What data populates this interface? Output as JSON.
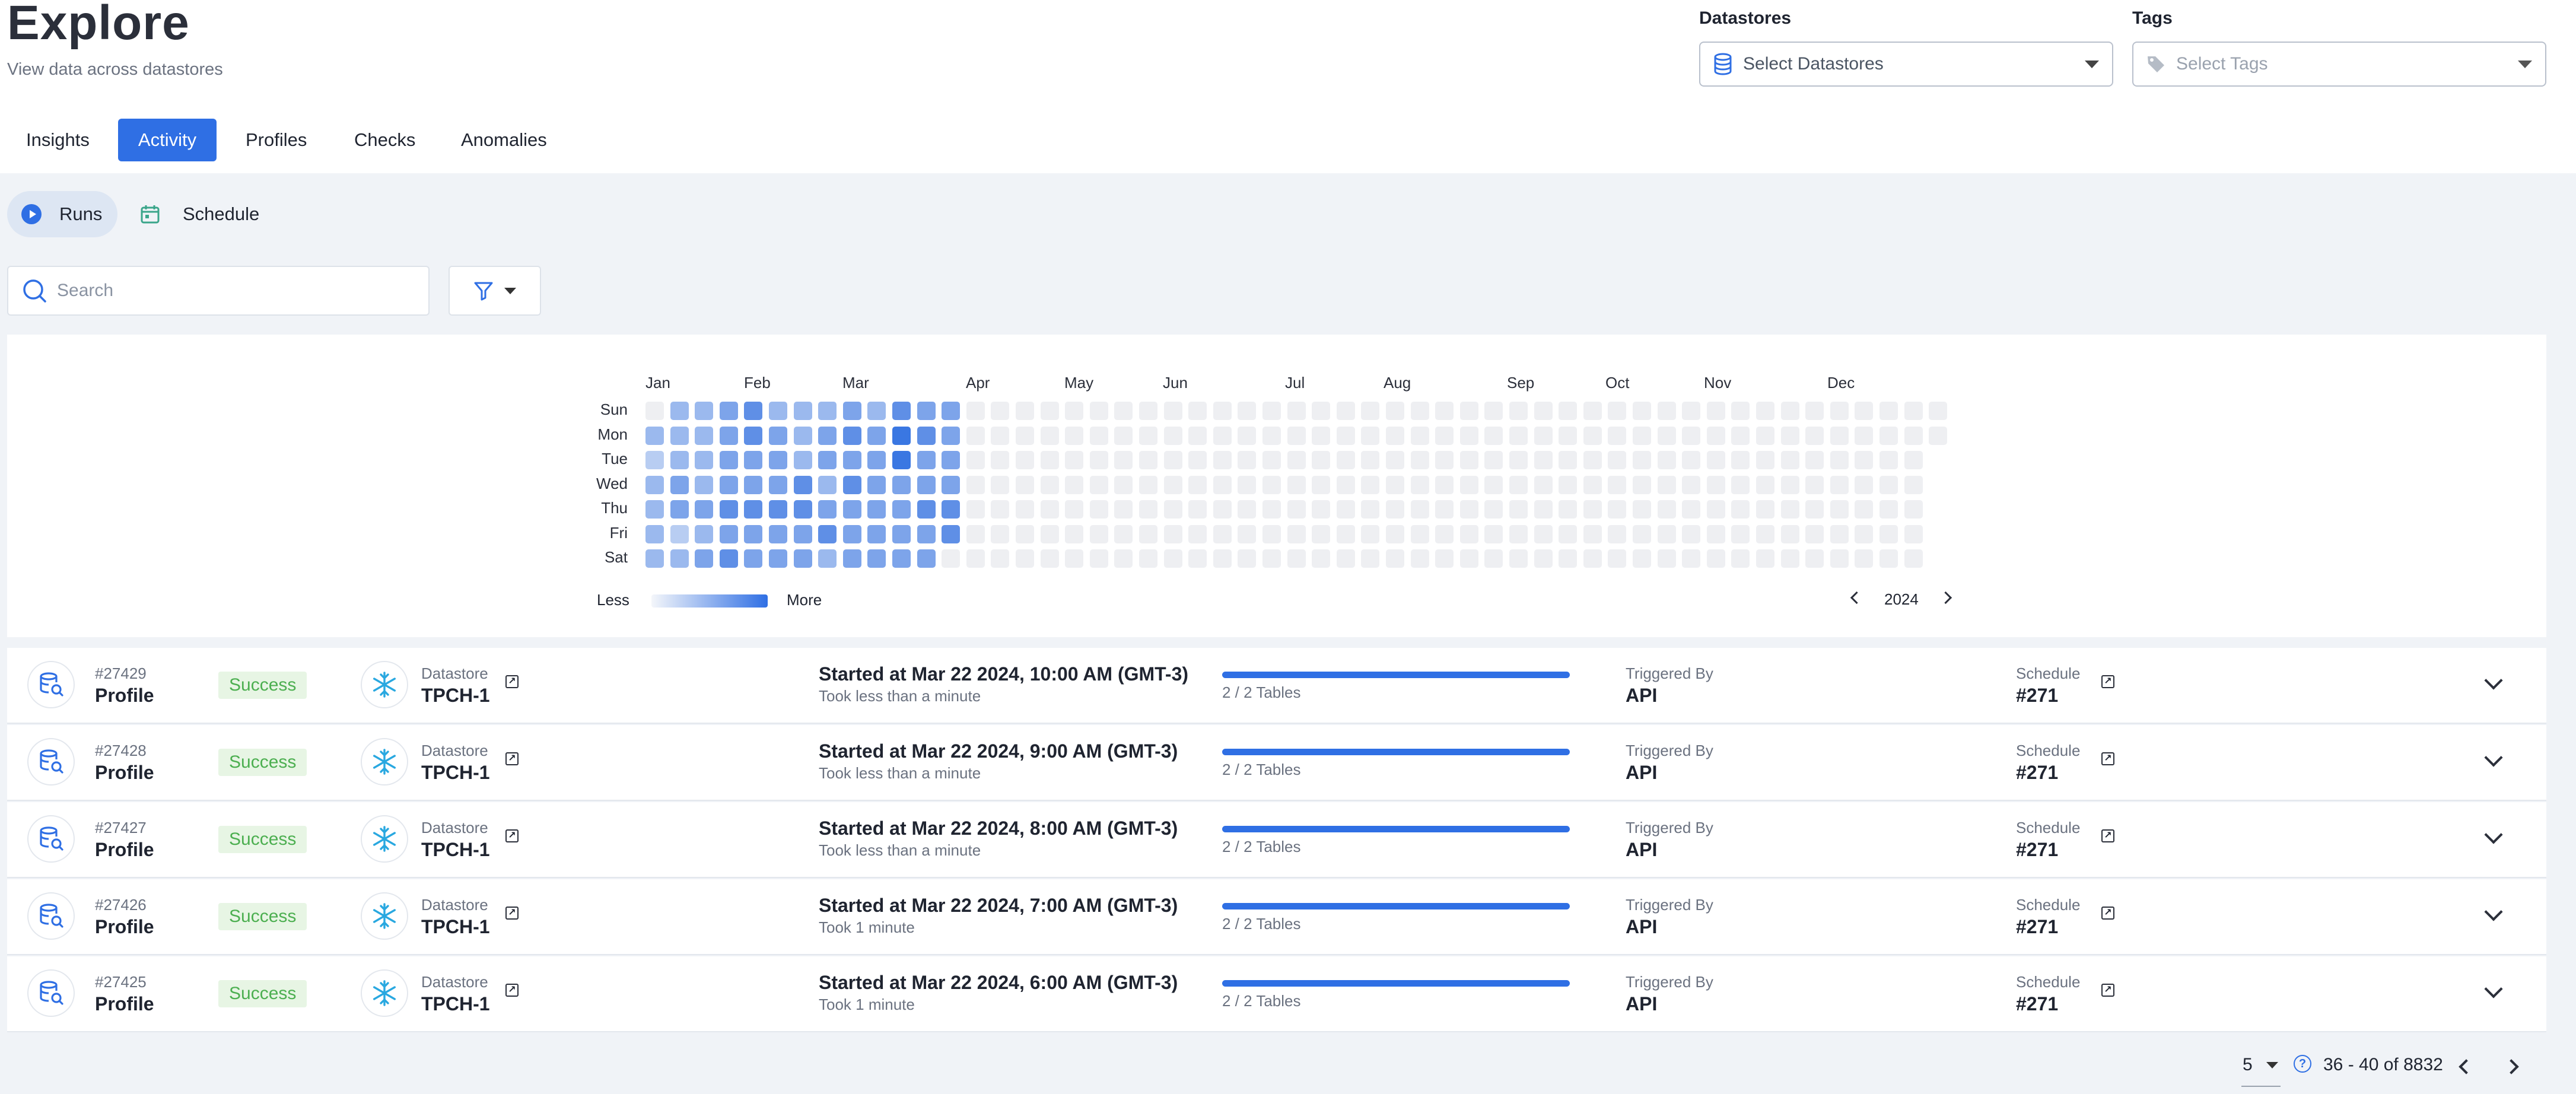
{
  "header": {
    "title": "Explore",
    "subtitle": "View data across datastores"
  },
  "filters": {
    "datastores_label": "Datastores",
    "datastores_placeholder": "Select Datastores",
    "tags_label": "Tags",
    "tags_placeholder": "Select Tags"
  },
  "tabs": [
    {
      "label": "Insights"
    },
    {
      "label": "Activity",
      "active": true
    },
    {
      "label": "Profiles"
    },
    {
      "label": "Checks"
    },
    {
      "label": "Anomalies"
    }
  ],
  "subtabs": {
    "runs": "Runs",
    "schedule": "Schedule"
  },
  "search": {
    "placeholder": "Search"
  },
  "heatmap": {
    "months": [
      "Jan",
      "Feb",
      "Mar",
      "Apr",
      "May",
      "Jun",
      "Jul",
      "Aug",
      "Sep",
      "Oct",
      "Nov",
      "Dec"
    ],
    "days": [
      "Sun",
      "Mon",
      "Tue",
      "Wed",
      "Thu",
      "Fri",
      "Sat"
    ],
    "legend_less": "Less",
    "legend_more": "More",
    "year": "2024",
    "colors": [
      "#eeeff2",
      "#b8cdf2",
      "#9bb9ee",
      "#7da4ea",
      "#5f8fe6",
      "#3a77e2"
    ],
    "activity_levels_by_week": [
      [
        0,
        2,
        1,
        2,
        2,
        2,
        2
      ],
      [
        2,
        2,
        2,
        3,
        3,
        1,
        2
      ],
      [
        2,
        2,
        2,
        2,
        3,
        2,
        3
      ],
      [
        3,
        3,
        3,
        3,
        4,
        3,
        4
      ],
      [
        4,
        4,
        3,
        3,
        4,
        3,
        3
      ],
      [
        2,
        3,
        3,
        3,
        4,
        3,
        3
      ],
      [
        2,
        2,
        2,
        4,
        4,
        3,
        3
      ],
      [
        2,
        3,
        3,
        2,
        3,
        4,
        2
      ],
      [
        3,
        4,
        3,
        4,
        3,
        3,
        3
      ],
      [
        2,
        3,
        3,
        3,
        3,
        3,
        3
      ],
      [
        4,
        5,
        5,
        3,
        3,
        3,
        3
      ],
      [
        3,
        4,
        3,
        3,
        4,
        3,
        3
      ],
      [
        3,
        3,
        3,
        3,
        4,
        4,
        0
      ]
    ],
    "total_weeks": 53
  },
  "runs": [
    {
      "id": "#27429",
      "type": "Profile",
      "status": "Success",
      "datastore_label": "Datastore",
      "datastore": "TPCH-1",
      "started": "Started at Mar 22 2024, 10:00 AM (GMT-3)",
      "took": "Took less than a minute",
      "progress_text": "2 / 2 Tables",
      "progress": 1.0,
      "triggered_label": "Triggered By",
      "triggered": "API",
      "schedule_label": "Schedule",
      "schedule": "#271"
    },
    {
      "id": "#27428",
      "type": "Profile",
      "status": "Success",
      "datastore_label": "Datastore",
      "datastore": "TPCH-1",
      "started": "Started at Mar 22 2024, 9:00 AM (GMT-3)",
      "took": "Took less than a minute",
      "progress_text": "2 / 2 Tables",
      "progress": 1.0,
      "triggered_label": "Triggered By",
      "triggered": "API",
      "schedule_label": "Schedule",
      "schedule": "#271"
    },
    {
      "id": "#27427",
      "type": "Profile",
      "status": "Success",
      "datastore_label": "Datastore",
      "datastore": "TPCH-1",
      "started": "Started at Mar 22 2024, 8:00 AM (GMT-3)",
      "took": "Took less than a minute",
      "progress_text": "2 / 2 Tables",
      "progress": 1.0,
      "triggered_label": "Triggered By",
      "triggered": "API",
      "schedule_label": "Schedule",
      "schedule": "#271"
    },
    {
      "id": "#27426",
      "type": "Profile",
      "status": "Success",
      "datastore_label": "Datastore",
      "datastore": "TPCH-1",
      "started": "Started at Mar 22 2024, 7:00 AM (GMT-3)",
      "took": "Took 1 minute",
      "progress_text": "2 / 2 Tables",
      "progress": 1.0,
      "triggered_label": "Triggered By",
      "triggered": "API",
      "schedule_label": "Schedule",
      "schedule": "#271"
    },
    {
      "id": "#27425",
      "type": "Profile",
      "status": "Success",
      "datastore_label": "Datastore",
      "datastore": "TPCH-1",
      "started": "Started at Mar 22 2024, 6:00 AM (GMT-3)",
      "took": "Took 1 minute",
      "progress_text": "2 / 2 Tables",
      "progress": 1.0,
      "triggered_label": "Triggered By",
      "triggered": "API",
      "schedule_label": "Schedule",
      "schedule": "#271"
    }
  ],
  "pagination": {
    "page_size": "5",
    "range": "36 - 40 of 8832"
  }
}
